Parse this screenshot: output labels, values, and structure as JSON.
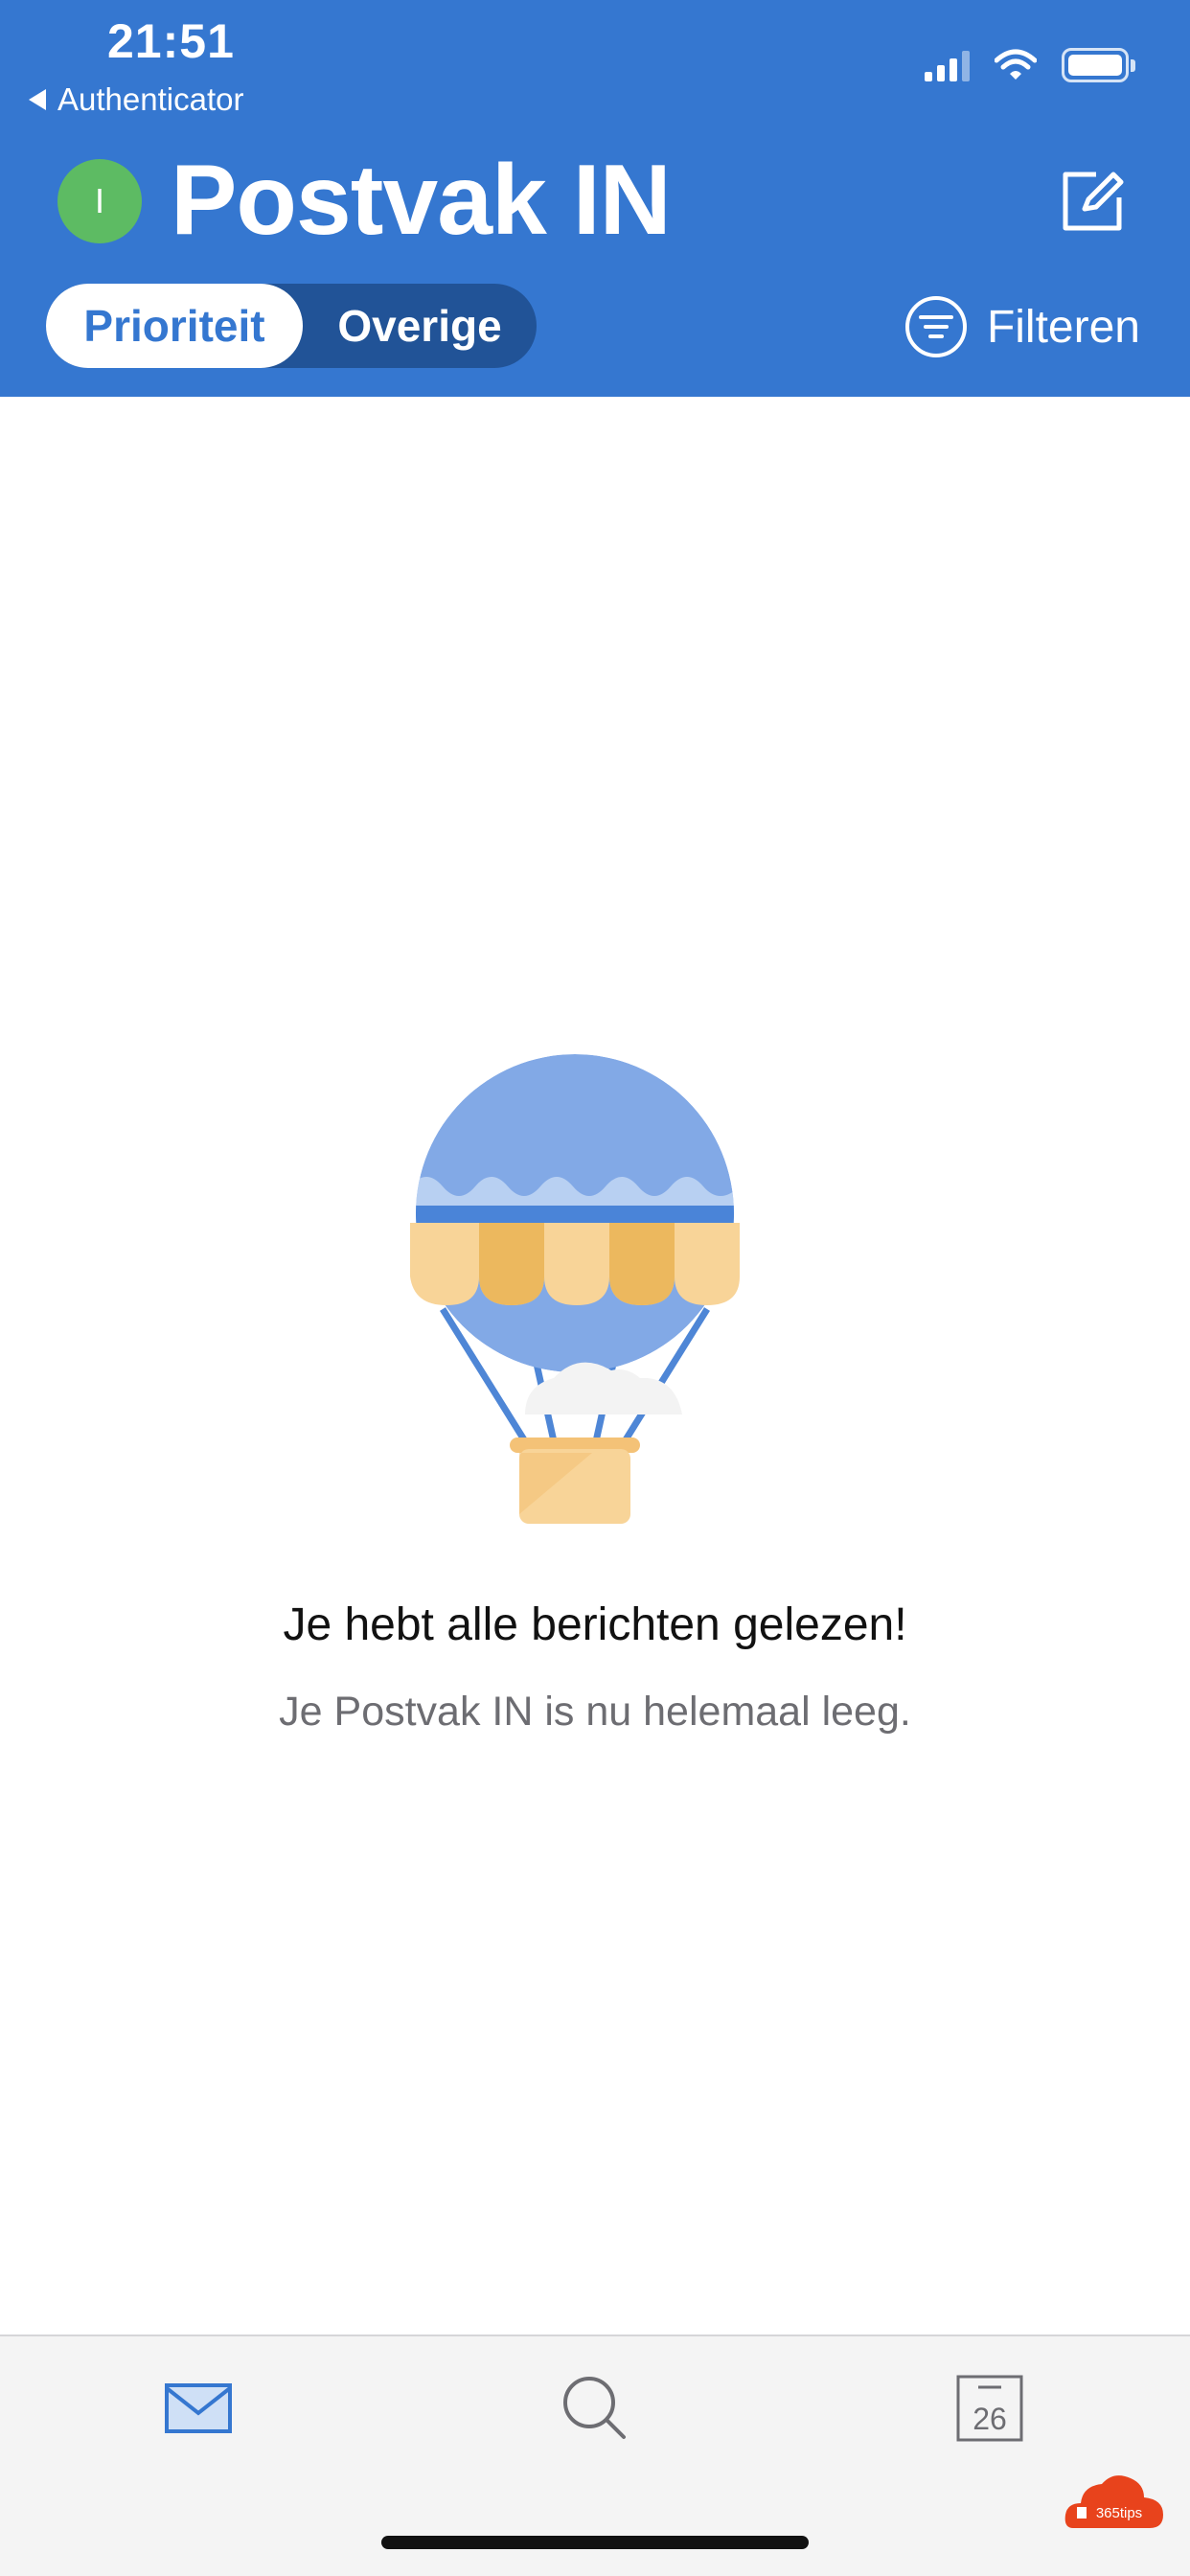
{
  "status_bar": {
    "time": "21:51",
    "back_app": "Authenticator",
    "icons": [
      "cellular-signal-icon",
      "wifi-icon",
      "battery-icon"
    ]
  },
  "header": {
    "avatar_initial": "I",
    "title": "Postvak IN",
    "compose_icon": "compose-icon",
    "tabs": [
      {
        "label": "Prioriteit",
        "selected": true
      },
      {
        "label": "Overige",
        "selected": false
      }
    ],
    "filter_label": "Filteren",
    "filter_icon": "filter-icon"
  },
  "empty_state": {
    "illustration": "hot-air-balloon-illustration",
    "title": "Je hebt alle berichten gelezen!",
    "subtitle": "Je Postvak IN is nu helemaal leeg."
  },
  "tabbar": {
    "items": [
      {
        "name": "mail",
        "icon": "mail-icon",
        "active": true
      },
      {
        "name": "search",
        "icon": "search-icon",
        "active": false
      },
      {
        "name": "calendar",
        "icon": "calendar-icon",
        "active": false,
        "day": "26"
      }
    ]
  },
  "watermark": {
    "text": "365tips"
  },
  "colors": {
    "header_blue": "#3577d0",
    "segment_dark": "#215397",
    "avatar_green": "#5dbb63",
    "tabbar_bg": "#f4f4f4"
  }
}
